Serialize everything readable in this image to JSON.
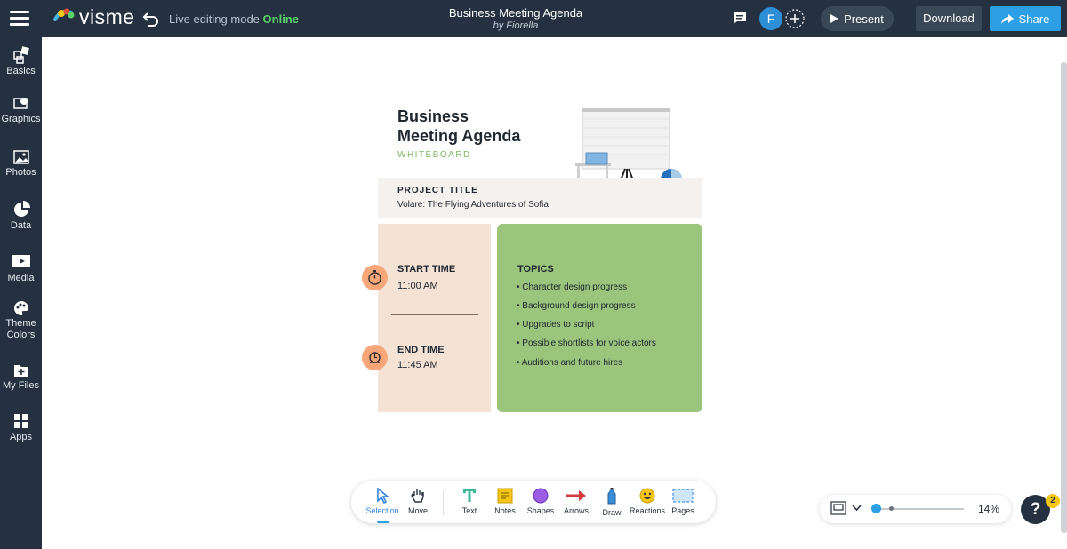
{
  "header": {
    "logo_text": "visme",
    "live_label": "Live editing mode",
    "live_status": "Online",
    "doc_title": "Business Meeting Agenda",
    "doc_author": "by Fiorella",
    "avatar_initial": "F",
    "present_label": "Present",
    "download_label": "Download",
    "share_label": "Share"
  },
  "sidebar": {
    "items": [
      {
        "label": "Basics",
        "icon": "basics-icon"
      },
      {
        "label": "Graphics",
        "icon": "graphics-icon"
      },
      {
        "label": "Photos",
        "icon": "photos-icon"
      },
      {
        "label": "Data",
        "icon": "pie-chart-icon"
      },
      {
        "label": "Media",
        "icon": "media-icon"
      },
      {
        "label": "Theme Colors",
        "icon": "palette-icon"
      },
      {
        "label": "My Files",
        "icon": "folder-icon"
      },
      {
        "label": "Apps",
        "icon": "grid-icon"
      }
    ]
  },
  "board": {
    "title_line1": "Business",
    "title_line2": "Meeting Agenda",
    "subtitle": "WHITEBOARD",
    "project_label": "PROJECT TITLE",
    "project_value": "Volare: The Flying Adventures of Sofia",
    "start_label": "START TIME",
    "start_value": "11:00 AM",
    "end_label": "END TIME",
    "end_value": "11:45 AM",
    "topics_title": "TOPICS",
    "topics": [
      "Character design progress",
      "Background design progress",
      "Upgrades to script",
      "Possible shortlists for voice actors",
      "Auditions and future hires"
    ],
    "colors": {
      "accent_green": "#9bc47c",
      "accent_peach": "#f4e2d4",
      "icon_orange": "#f7a679"
    }
  },
  "toolbar": {
    "tools": [
      {
        "label": "Selection",
        "icon": "cursor-icon",
        "active": true
      },
      {
        "label": "Move",
        "icon": "hand-icon"
      },
      {
        "label": "Text",
        "icon": "text-icon"
      },
      {
        "label": "Notes",
        "icon": "note-icon"
      },
      {
        "label": "Shapes",
        "icon": "circle-shape-icon"
      },
      {
        "label": "Arrows",
        "icon": "arrow-icon"
      },
      {
        "label": "Draw",
        "icon": "pen-icon"
      },
      {
        "label": "Reactions",
        "icon": "emoji-icon"
      },
      {
        "label": "Pages",
        "icon": "pages-icon"
      }
    ]
  },
  "zoom": {
    "value": "14%"
  },
  "help": {
    "label": "?",
    "badge_count": "2"
  }
}
